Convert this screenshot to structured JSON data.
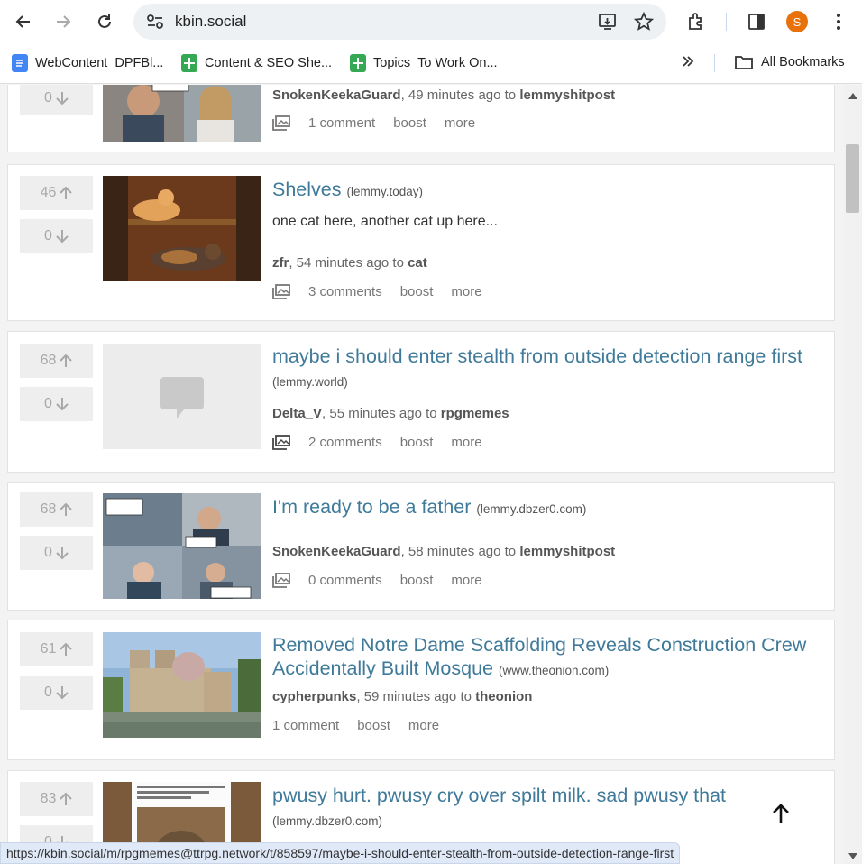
{
  "browser": {
    "url": "kbin.social",
    "avatar_letter": "S",
    "bookmarks": [
      {
        "label": "WebContent_DPFBl...",
        "icon": "docs-icon",
        "color": "#4285f4"
      },
      {
        "label": "Content & SEO She...",
        "icon": "sheets-icon",
        "color": "#34a853"
      },
      {
        "label": "Topics_To Work On...",
        "icon": "sheets-icon",
        "color": "#34a853"
      }
    ],
    "all_bookmarks": "All Bookmarks",
    "status_url": "https://kbin.social/m/rpgmemes@ttrpg.network/t/858597/maybe-i-should-enter-stealth-from-outside-detection-range-first"
  },
  "posts": [
    {
      "up": "",
      "down": "0",
      "title": "",
      "domain": "",
      "body": "",
      "author": "SnokenKeekaGuard",
      "time": ", 49 minutes ago to ",
      "magazine": "lemmyshitpost",
      "comments": "1 comment",
      "boost": "boost",
      "more": "more"
    },
    {
      "up": "46",
      "down": "0",
      "title": "Shelves",
      "domain": "(lemmy.today)",
      "body": "one cat here, another cat up here...",
      "author": "zfr",
      "time": ", 54 minutes ago to ",
      "magazine": "cat",
      "comments": "3 comments",
      "boost": "boost",
      "more": "more"
    },
    {
      "up": "68",
      "down": "0",
      "title": "maybe i should enter stealth from outside detection range first",
      "domain": "(lemmy.world)",
      "body": "",
      "author": "Delta_V",
      "time": ", 55 minutes ago to ",
      "magazine": "rpgmemes",
      "comments": "2 comments",
      "boost": "boost",
      "more": "more"
    },
    {
      "up": "68",
      "down": "0",
      "title": "I'm ready to be a father",
      "domain": "(lemmy.dbzer0.com)",
      "body": "",
      "author": "SnokenKeekaGuard",
      "time": ", 58 minutes ago to ",
      "magazine": "lemmyshitpost",
      "comments": "0 comments",
      "boost": "boost",
      "more": "more"
    },
    {
      "up": "61",
      "down": "0",
      "title": "Removed Notre Dame Scaffolding Reveals Construction Crew Accidentally Built Mosque",
      "domain": "(www.theonion.com)",
      "body": "",
      "author": "cypherpunks",
      "time": ", 59 minutes ago to ",
      "magazine": "theonion",
      "comments": "1 comment",
      "boost": "boost",
      "more": "more"
    },
    {
      "up": "83",
      "down": "0",
      "title": "pwusy hurt. pwusy cry over spilt milk. sad pwusy that",
      "domain": "(lemmy.dbzer0.com)",
      "body": "",
      "author": "",
      "time": "",
      "magazine": "",
      "comments": "",
      "boost": "",
      "more": ""
    }
  ]
}
